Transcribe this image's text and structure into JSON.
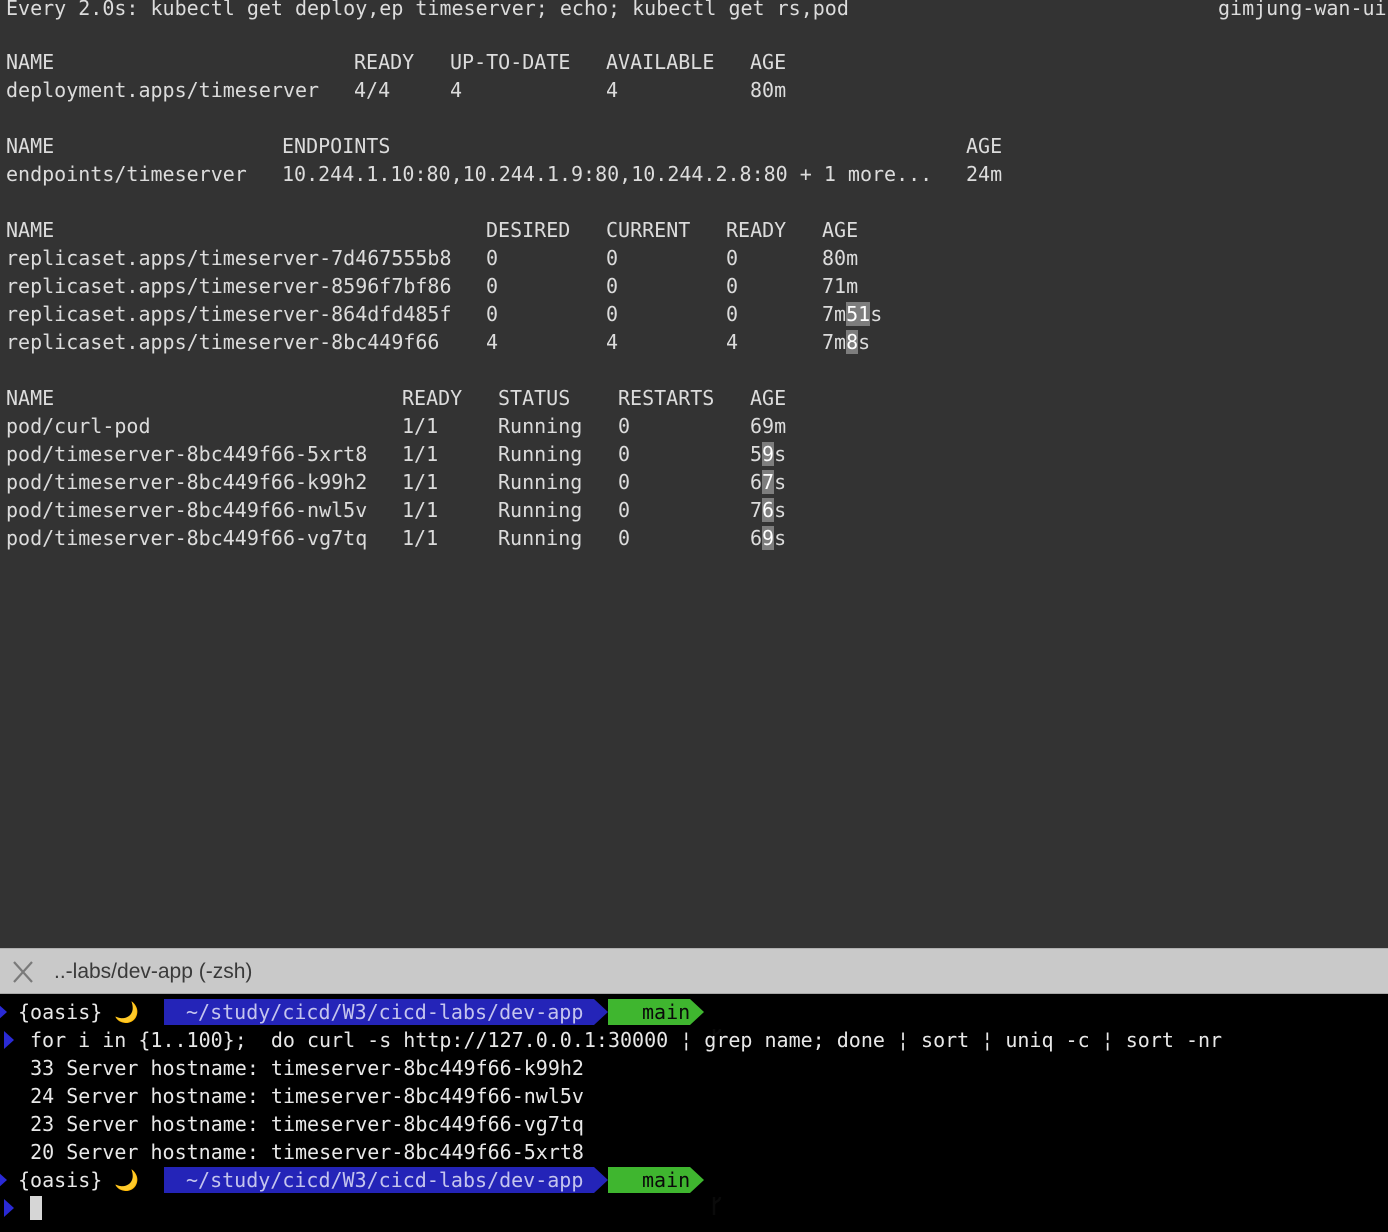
{
  "watch_pane": {
    "header": {
      "command": "Every 2.0s: kubectl get deploy,ep timeserver; echo; kubectl get rs,pod",
      "host": "gimjung-wan-ui"
    },
    "deployments": {
      "headers": [
        "NAME",
        "READY",
        "UP-TO-DATE",
        "AVAILABLE",
        "AGE"
      ],
      "rows": [
        [
          "deployment.apps/timeserver",
          "4/4",
          "4",
          "4",
          "80m"
        ]
      ]
    },
    "endpoints": {
      "headers": [
        "NAME",
        "ENDPOINTS",
        "AGE"
      ],
      "rows": [
        [
          "endpoints/timeserver",
          "10.244.1.10:80,10.244.1.9:80,10.244.2.8:80 + 1 more...",
          "24m"
        ]
      ]
    },
    "replicasets": {
      "headers": [
        "NAME",
        "DESIRED",
        "CURRENT",
        "READY",
        "AGE"
      ],
      "rows": [
        [
          "replicaset.apps/timeserver-7d467555b8",
          "0",
          "0",
          "0",
          "80m"
        ],
        [
          "replicaset.apps/timeserver-8596f7bf86",
          "0",
          "0",
          "0",
          "71m"
        ],
        [
          "replicaset.apps/timeserver-864dfd485f",
          "0",
          "0",
          "0",
          "7m51s"
        ],
        [
          "replicaset.apps/timeserver-8bc449f66",
          "4",
          "4",
          "4",
          "7m8s"
        ]
      ]
    },
    "pods": {
      "headers": [
        "NAME",
        "READY",
        "STATUS",
        "RESTARTS",
        "AGE"
      ],
      "rows": [
        [
          "pod/curl-pod",
          "1/1",
          "Running",
          "0",
          "69m"
        ],
        [
          "pod/timeserver-8bc449f66-5xrt8",
          "1/1",
          "Running",
          "0",
          "59s"
        ],
        [
          "pod/timeserver-8bc449f66-k99h2",
          "1/1",
          "Running",
          "0",
          "67s"
        ],
        [
          "pod/timeserver-8bc449f66-nwl5v",
          "1/1",
          "Running",
          "0",
          "76s"
        ],
        [
          "pod/timeserver-8bc449f66-vg7tq",
          "1/1",
          "Running",
          "0",
          "69s"
        ]
      ]
    }
  },
  "tab": {
    "title": "..-labs/dev-app (-zsh)",
    "close_icon": "close-icon"
  },
  "shell_pane": {
    "prompt": {
      "env": "{oasis}",
      "moon_icon": "🌙",
      "path": "~/study/cicd/W3/cicd-labs/dev-app",
      "git_icon": "git-branch-icon",
      "branch": "main"
    },
    "command": "for i in {1..100};  do curl -s http://127.0.0.1:30000 ¦ grep name; done ¦ sort ¦ uniq -c ¦ sort -nr",
    "output": [
      "  33 Server hostname: timeserver-8bc449f66-k99h2",
      "  24 Server hostname: timeserver-8bc449f66-nwl5v",
      "  23 Server hostname: timeserver-8bc449f66-vg7tq",
      "  20 Server hostname: timeserver-8bc449f66-5xrt8"
    ],
    "colors": {
      "path_bg": "#2424b8",
      "git_bg": "#3fb62f",
      "chevron": "#2a2ad6"
    }
  }
}
